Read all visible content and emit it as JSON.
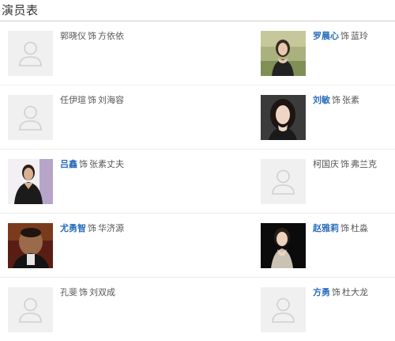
{
  "section_title": "演员表",
  "as_word": "饰",
  "cast": [
    {
      "left": {
        "actor": "郭晓仪",
        "role": "方依依",
        "linked": false,
        "photo": "placeholder-avatar-icon"
      },
      "right": {
        "actor": "罗晨心",
        "role": "蓝玲",
        "linked": true,
        "photo": "photo-portrait"
      }
    },
    {
      "left": {
        "actor": "任伊瑄",
        "role": "刘海容",
        "linked": false,
        "photo": "placeholder-avatar-icon"
      },
      "right": {
        "actor": "刘敏",
        "role": "张素",
        "linked": true,
        "photo": "photo-portrait"
      }
    },
    {
      "left": {
        "actor": "吕鑫",
        "role": "张素丈夫",
        "linked": true,
        "photo": "photo-portrait"
      },
      "right": {
        "actor": "柯国庆",
        "role": "弗兰克",
        "linked": false,
        "photo": "placeholder-avatar-icon"
      }
    },
    {
      "left": {
        "actor": "尤勇智",
        "role": "华济源",
        "linked": true,
        "photo": "photo-portrait"
      },
      "right": {
        "actor": "赵雅莉",
        "role": "杜淼",
        "linked": true,
        "photo": "photo-portrait"
      }
    },
    {
      "left": {
        "actor": "孔斐",
        "role": "刘双成",
        "linked": false,
        "photo": "placeholder-avatar-icon"
      },
      "right": {
        "actor": "方勇",
        "role": "杜大龙",
        "linked": true,
        "photo": "placeholder-avatar-icon"
      }
    }
  ],
  "colors": {
    "link": "#2a6ebb",
    "text": "#555555",
    "placeholder_bg": "#f0f0f0",
    "divider": "#ececec"
  }
}
